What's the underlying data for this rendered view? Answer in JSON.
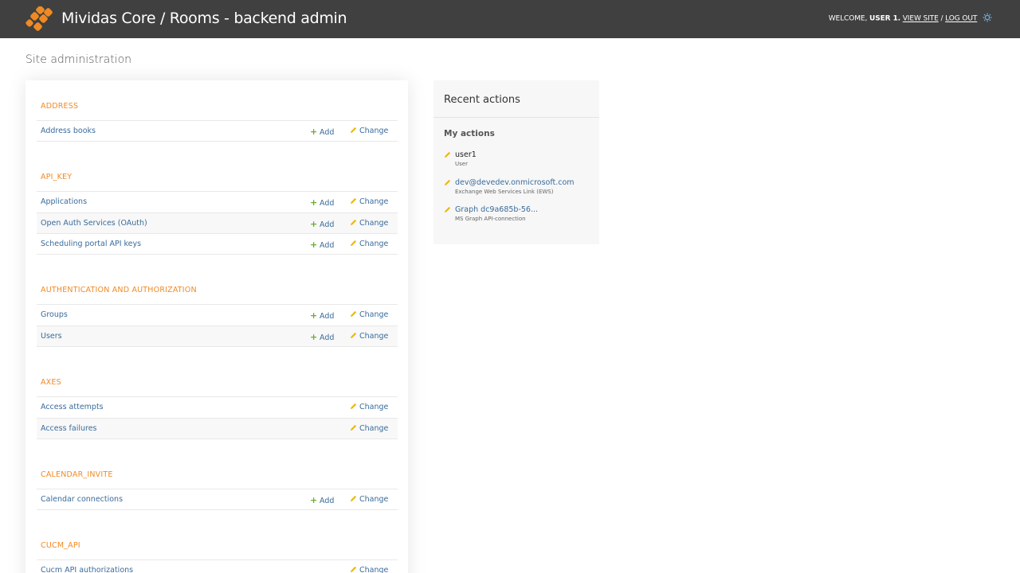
{
  "header": {
    "title": "Mividas Core / Rooms - backend admin",
    "welcome": "WELCOME,",
    "user": "USER 1.",
    "view_site": "VIEW SITE",
    "separator": "/",
    "log_out": "LOG OUT",
    "theme_icon": "theme-toggle-icon",
    "logo_icon": "mividas-logo-icon",
    "colors": {
      "bar": "#404040",
      "logo": "#f08a24"
    }
  },
  "page": {
    "heading": "Site administration"
  },
  "common": {
    "add_label": "Add",
    "change_label": "Change",
    "add_icon": "plus-icon",
    "change_icon": "pencil-icon"
  },
  "modules": [
    {
      "caption": "ADDRESS",
      "rows": [
        {
          "name": "Address books",
          "has_add": true
        }
      ]
    },
    {
      "caption": "API_KEY",
      "rows": [
        {
          "name": "Applications",
          "has_add": true
        },
        {
          "name": "Open Auth Services (OAuth)",
          "has_add": true
        },
        {
          "name": "Scheduling portal API keys",
          "has_add": true
        }
      ]
    },
    {
      "caption": "AUTHENTICATION AND AUTHORIZATION",
      "rows": [
        {
          "name": "Groups",
          "has_add": true
        },
        {
          "name": "Users",
          "has_add": true
        }
      ]
    },
    {
      "caption": "AXES",
      "rows": [
        {
          "name": "Access attempts",
          "has_add": false
        },
        {
          "name": "Access failures",
          "has_add": false
        }
      ]
    },
    {
      "caption": "CALENDAR_INVITE",
      "rows": [
        {
          "name": "Calendar connections",
          "has_add": true
        }
      ]
    },
    {
      "caption": "CUCM_API",
      "rows": [
        {
          "name": "Cucm API authorizations",
          "has_add": false
        }
      ]
    }
  ],
  "recent_actions": {
    "title": "Recent actions",
    "my_actions_title": "My actions",
    "items": [
      {
        "name": "user1",
        "type": "User",
        "linked": false
      },
      {
        "name": "dev@devedev.onmicrosoft.com",
        "type": "Exchange Web Services Link (EWS)",
        "linked": true
      },
      {
        "name": "Graph dc9a685b-56...",
        "type": "MS Graph API-connection",
        "linked": true
      }
    ]
  }
}
